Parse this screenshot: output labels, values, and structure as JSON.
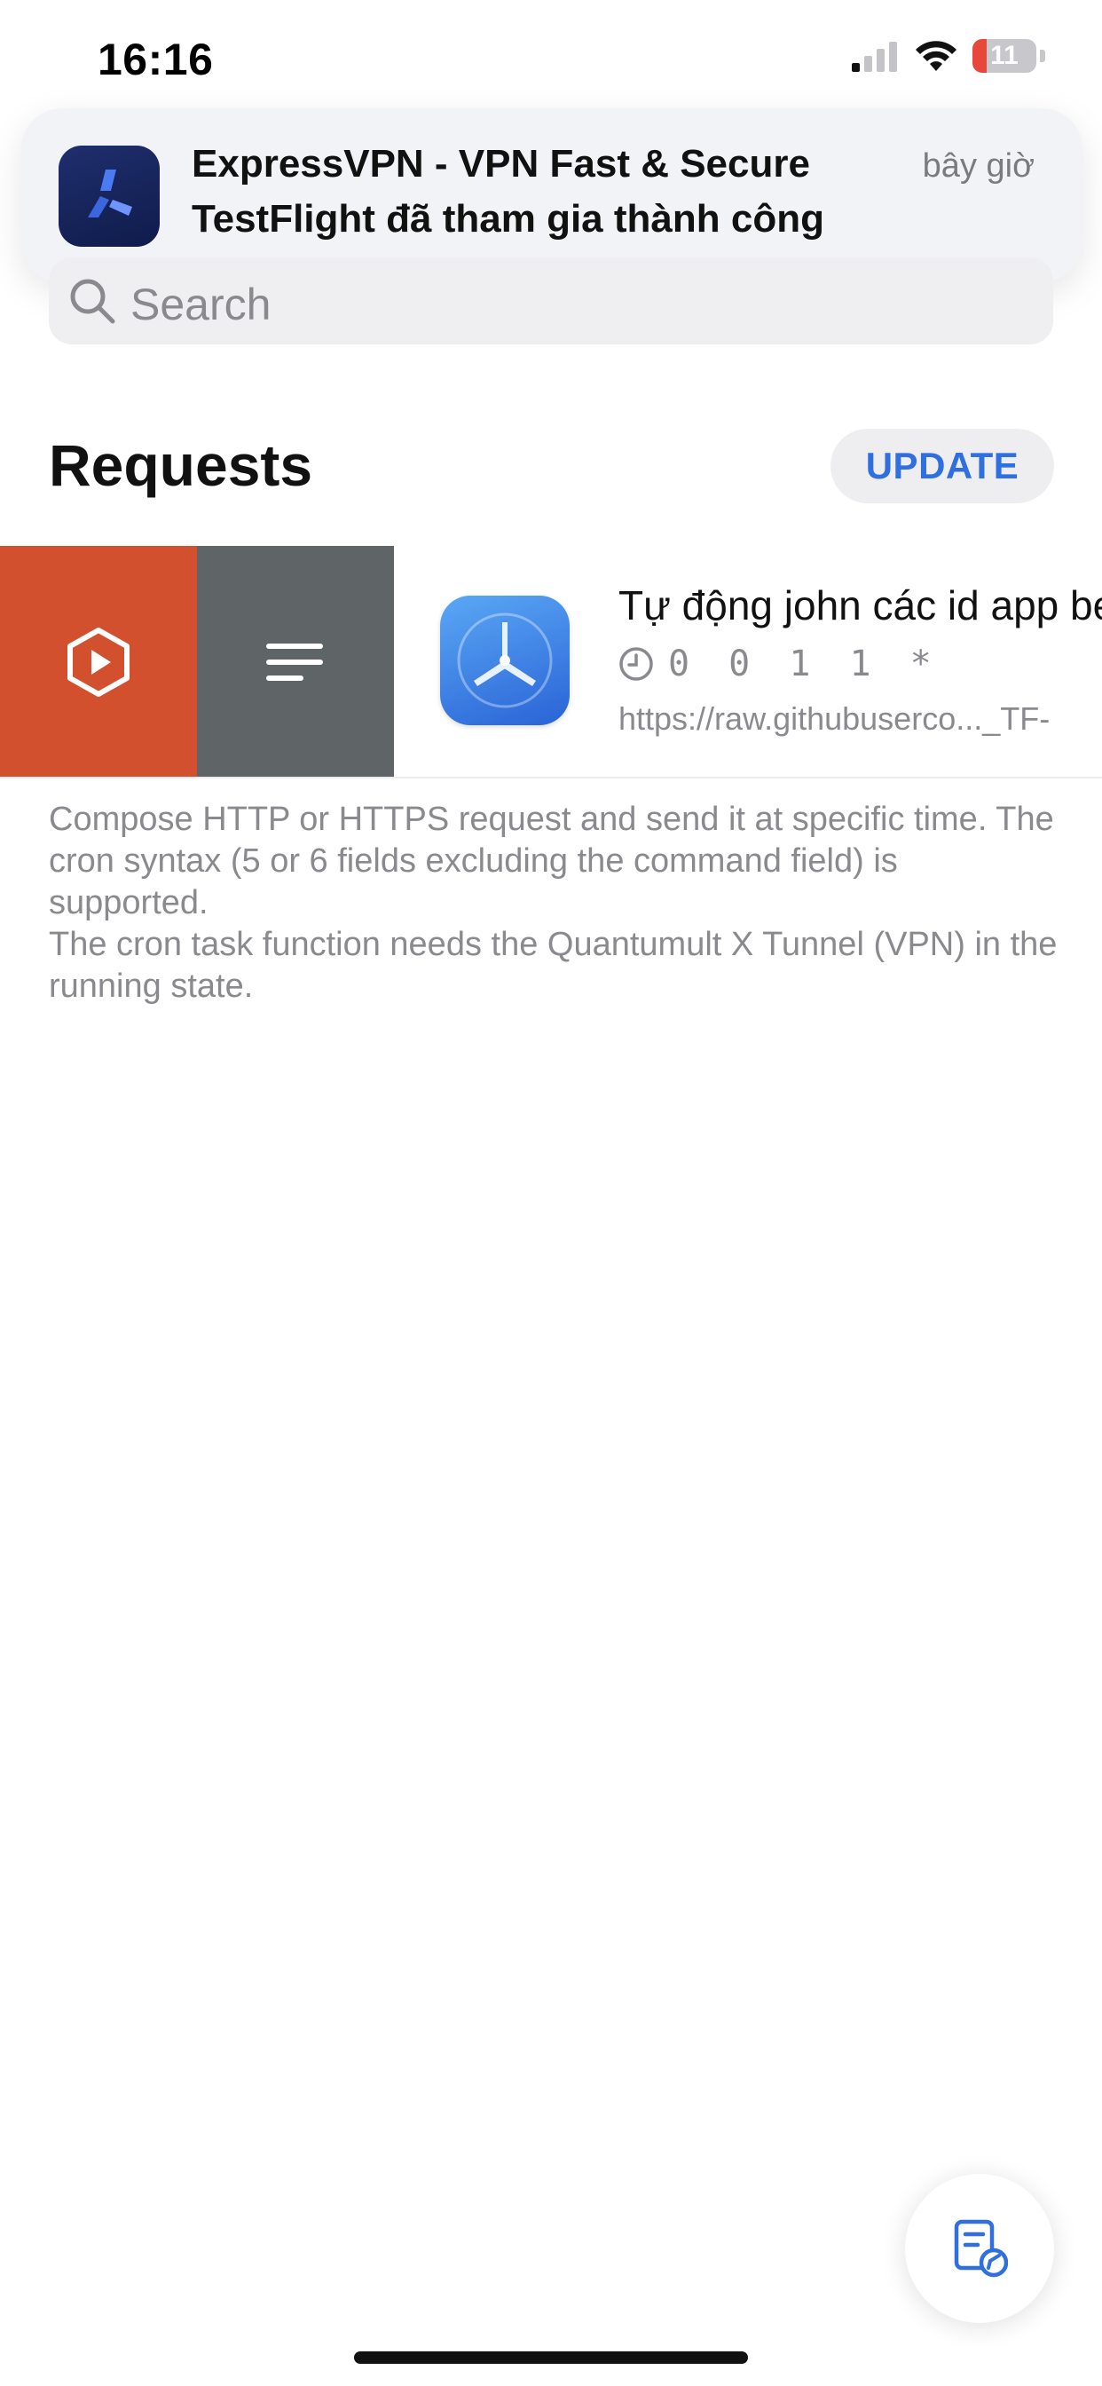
{
  "status_bar": {
    "time": "16:16",
    "battery_level": "11",
    "icons": [
      "cellular-signal-icon",
      "wifi-icon",
      "battery-icon"
    ]
  },
  "notification": {
    "app_icon": "expressvpn-icon",
    "title": "ExpressVPN - VPN Fast & Secure",
    "body": "TestFlight đã tham gia thành công",
    "time": "bây giờ"
  },
  "search": {
    "placeholder": "Search",
    "icon": "search-icon"
  },
  "header": {
    "title": "Requests",
    "update_label": "UPDATE"
  },
  "request_row": {
    "actions": [
      {
        "icon": "play-icon",
        "color": "#d2502e"
      },
      {
        "icon": "menu-lines-icon",
        "color": "#5f6467"
      }
    ],
    "app_icon": "testflight-icon",
    "title": "Tự động john các id app be",
    "cron": "0 0 1 1 *",
    "url": "https://raw.githubuserco..._TF-"
  },
  "footer": {
    "lines": [
      "Compose HTTP or HTTPS request and send it at specific time. The cron syntax (5 or 6 fields excluding the command field) is supported.",
      "The cron task function needs the Quantumult X Tunnel (VPN) in the running state."
    ]
  },
  "fab": {
    "icon": "compose-document-icon"
  },
  "colors": {
    "accent": "#2f6fe0",
    "run_action": "#d2502e",
    "edit_action": "#5f6467",
    "battery_low": "#e8473c"
  }
}
